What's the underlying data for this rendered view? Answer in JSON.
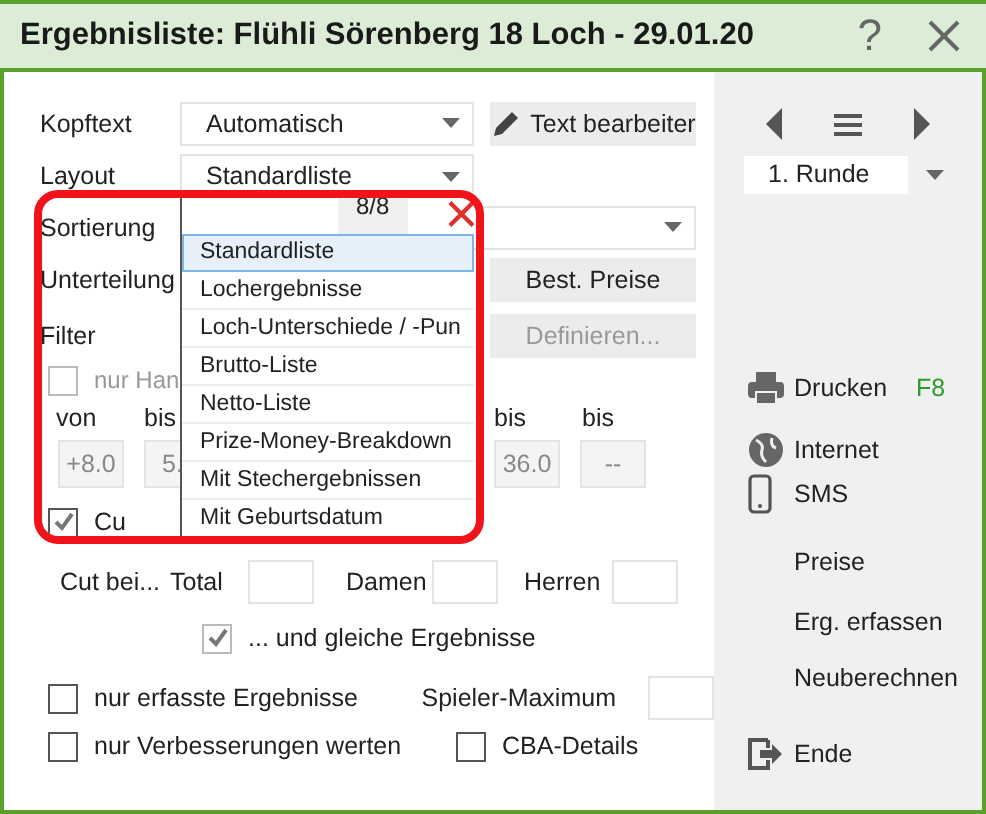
{
  "window": {
    "title": "Ergebnisliste: Flühli Sörenberg 18 Loch - 29.01.20",
    "help": "?"
  },
  "form": {
    "kopftext": {
      "label": "Kopftext",
      "value": "Automatisch"
    },
    "text_button": "Text bearbeiter",
    "layout": {
      "label": "Layout",
      "value": "Standardliste"
    },
    "sortierung": {
      "label": "Sortierung"
    },
    "unterteilung": {
      "label": "Unterteilung"
    },
    "best_preise_button": "Best. Preise",
    "filter": {
      "label": "Filter"
    },
    "definieren_button": {
      "label": "Definieren...",
      "disabled": true
    },
    "hand_checkbox": {
      "label": "nur Han",
      "checked": false,
      "disabled": true
    },
    "range_labels": [
      "von",
      "bis",
      "bis",
      "bis"
    ],
    "range_values": [
      "+8.0",
      "5.",
      "36.0",
      "--"
    ],
    "cut_checkbox": {
      "label": "Cu",
      "checked": true,
      "disabled": false
    },
    "cut_label": "Cut bei...",
    "cut_fields": [
      {
        "label": "Total"
      },
      {
        "label": "Damen"
      },
      {
        "label": "Herren"
      }
    ],
    "gleiche_checkbox": {
      "label": "... und gleiche Ergebnisse",
      "checked": true,
      "disabled": true
    },
    "erfasste_checkbox": {
      "label": "nur erfasste Ergebnisse",
      "checked": false,
      "disabled": false
    },
    "spieler_maximum": {
      "label": "Spieler-Maximum"
    },
    "verbesserungen_checkbox": {
      "label": "nur Verbesserungen werten",
      "checked": false,
      "disabled": false
    },
    "cba_checkbox": {
      "label": "CBA-Details",
      "checked": false,
      "disabled": false
    }
  },
  "dropdown": {
    "count": "8/8",
    "items": [
      {
        "label": "Standardliste",
        "selected": true
      },
      {
        "label": "Lochergebnisse",
        "selected": false
      },
      {
        "label": "Loch-Unterschiede / -Pun",
        "selected": false
      },
      {
        "label": "Brutto-Liste",
        "selected": false
      },
      {
        "label": "Netto-Liste",
        "selected": false
      },
      {
        "label": "Prize-Money-Breakdown",
        "selected": false
      },
      {
        "label": "Mit Stechergebnissen",
        "selected": false
      },
      {
        "label": "Mit Geburtsdatum",
        "selected": false
      }
    ]
  },
  "sidebar": {
    "round": "1. Runde",
    "actions": [
      {
        "label": "Drucken",
        "shortcut": "F8",
        "kind": "printer"
      },
      {
        "label": "Internet",
        "kind": "globe"
      },
      {
        "label": "SMS",
        "kind": "phone"
      },
      {
        "label": "Preise",
        "kind": "plain"
      },
      {
        "label": "Erg. erfassen",
        "kind": "plain"
      },
      {
        "label": "Neuberechnen",
        "kind": "plain"
      },
      {
        "label": "Ende",
        "kind": "exit"
      }
    ]
  }
}
